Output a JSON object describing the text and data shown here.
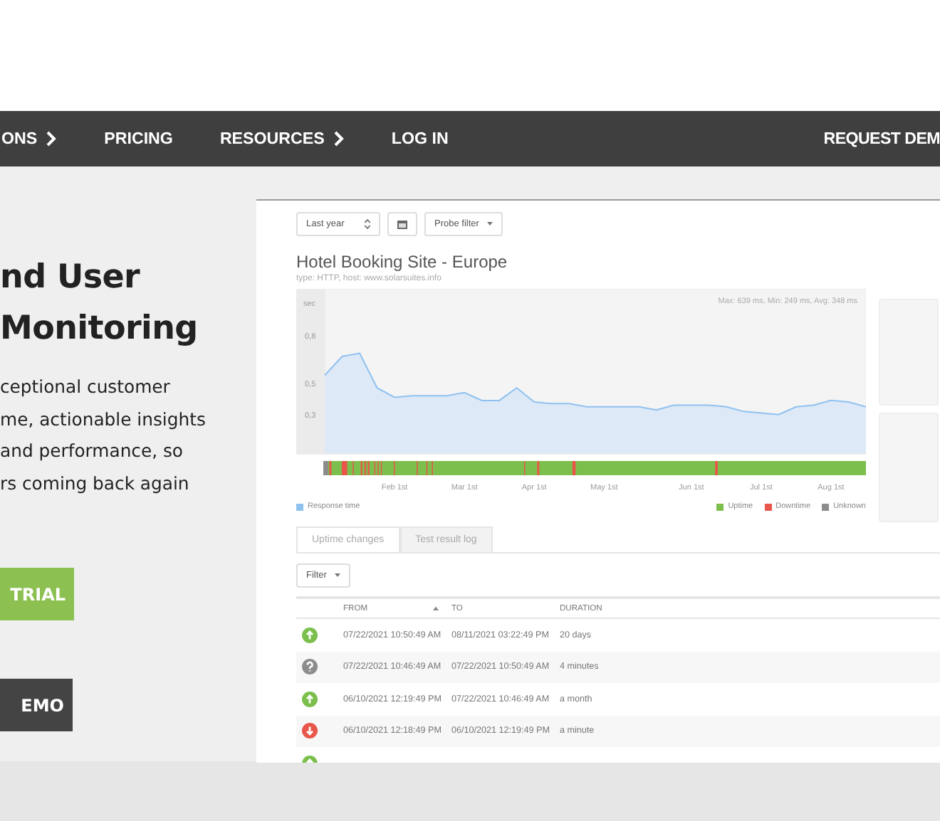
{
  "nav": {
    "items": [
      {
        "label": "ONS",
        "has_chevron": true
      },
      {
        "label": "PRICING",
        "has_chevron": false
      },
      {
        "label": "RESOURCES",
        "has_chevron": true
      },
      {
        "label": "LOG IN",
        "has_chevron": false
      }
    ],
    "cta": "REQUEST DEM"
  },
  "hero": {
    "heading_lines": [
      "nd User",
      "Monitoring"
    ],
    "text_lines": [
      "ceptional customer",
      "me, actionable insights",
      "and performance, so",
      "rs coming back again"
    ],
    "buttons": [
      {
        "label": "TRIAL",
        "kind": "primary"
      },
      {
        "label": "EMO",
        "kind": "dark"
      }
    ]
  },
  "dashboard": {
    "period": "Last year",
    "probe_filter": "Probe filter",
    "title": "Hotel Booking Site - Europe",
    "subtitle": "type: HTTP, host: www.solarsuites.info",
    "chart_data": {
      "type": "area",
      "ylabel": "sec",
      "categories": [
        null,
        null,
        null,
        null,
        "Feb 1st",
        null,
        null,
        null,
        "Mar 1st",
        null,
        null,
        null,
        "Apr 1st",
        null,
        null,
        null,
        "May 1st",
        null,
        null,
        null,
        null,
        "Jun 1st",
        null,
        null,
        null,
        "Jul 1st",
        null,
        null,
        null,
        "Aug 1st",
        null,
        null
      ],
      "series": [
        {
          "name": "Response time",
          "color": "#8fc1f0",
          "values": [
            0.55,
            0.67,
            0.69,
            0.47,
            0.41,
            0.42,
            0.42,
            0.42,
            0.44,
            0.39,
            0.39,
            0.47,
            0.38,
            0.37,
            0.37,
            0.35,
            0.35,
            0.35,
            0.35,
            0.33,
            0.36,
            0.36,
            0.36,
            0.35,
            0.32,
            0.31,
            0.3,
            0.35,
            0.36,
            0.39,
            0.38,
            0.35
          ]
        }
      ],
      "ylim": [
        0.05,
        1.1
      ],
      "yticks": [
        {
          "value": 0.8,
          "label": "0,8"
        },
        {
          "value": 0.5,
          "label": "0,5"
        },
        {
          "value": 0.3,
          "label": "0,3"
        }
      ],
      "annotations": [
        "Max: 639 ms, Min: 249 ms, Avg: 348 ms"
      ]
    },
    "legend": [
      {
        "label": "Uptime",
        "color": "#7cbf4d"
      },
      {
        "label": "Downtime",
        "color": "#e8574a"
      },
      {
        "label": "Unknown",
        "color": "#8c8c8c"
      }
    ],
    "tabs": [
      {
        "label": "Uptime changes",
        "selected": true
      },
      {
        "label": "Test result log",
        "selected": false
      }
    ],
    "filter": "Filter",
    "table": {
      "columns": [
        "FROM",
        "TO",
        "DURATION"
      ],
      "rows": [
        {
          "kind": "up",
          "from": "07/22/2021 10:50:49 AM",
          "to": "08/11/2021 03:22:49 PM",
          "duration": "20 days"
        },
        {
          "kind": "unknown",
          "from": "07/22/2021 10:46:49 AM",
          "to": "07/22/2021 10:50:49 AM",
          "duration": "4 minutes"
        },
        {
          "kind": "up",
          "from": "06/10/2021 12:19:49 PM",
          "to": "07/22/2021 10:46:49 AM",
          "duration": "a month"
        },
        {
          "kind": "down",
          "from": "06/10/2021 12:18:49 PM",
          "to": "06/10/2021 12:19:49 PM",
          "duration": "a minute"
        },
        {
          "kind": "up"
        }
      ]
    }
  }
}
